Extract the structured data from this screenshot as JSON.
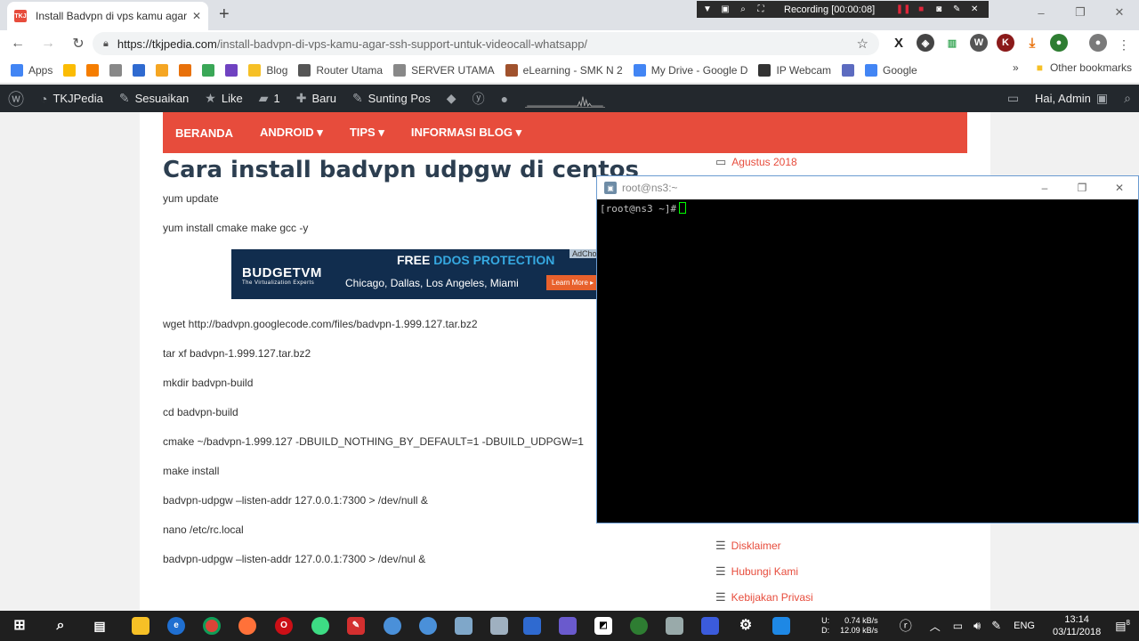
{
  "browser": {
    "tab_title": "Install Badvpn di vps kamu agar s",
    "new_tab": "+",
    "url_host": "https://tkjpedia.com",
    "url_path": "/install-badvpn-di-vps-kamu-agar-ssh-support-untuk-videocall-whatsapp/",
    "window_controls": [
      "–",
      "❐",
      "✕"
    ],
    "recording_label": "Recording [00:00:08]"
  },
  "bookmarks": {
    "items": [
      {
        "label": "Apps",
        "icon": "apps-grid-icon",
        "color": "#4285f4"
      },
      {
        "label": "",
        "icon": "google-ads-icon",
        "color": "#fbbc04"
      },
      {
        "label": "",
        "icon": "blogger-icon",
        "color": "#f57d00"
      },
      {
        "label": "",
        "icon": "page-icon",
        "color": "#888888"
      },
      {
        "label": "",
        "icon": "router-icon",
        "color": "#2f6ad0"
      },
      {
        "label": "",
        "icon": "signal-icon",
        "color": "#f5a623"
      },
      {
        "label": "",
        "icon": "analytics-icon",
        "color": "#e8710a"
      },
      {
        "label": "",
        "icon": "green-app-icon",
        "color": "#3aa757"
      },
      {
        "label": "",
        "icon": "b-icon",
        "color": "#6f42c1"
      },
      {
        "label": "Blog",
        "icon": "folder-icon",
        "color": "#f6c026"
      },
      {
        "label": "Router Utama",
        "icon": "router-icon",
        "color": "#555555"
      },
      {
        "label": "SERVER UTAMA",
        "icon": "page-icon",
        "color": "#888888"
      },
      {
        "label": "eLearning - SMK N 2",
        "icon": "school-icon",
        "color": "#a0522d"
      },
      {
        "label": "My Drive - Google D",
        "icon": "google-icon",
        "color": "#4285f4"
      },
      {
        "label": "IP Webcam",
        "icon": "webcam-icon",
        "color": "#333333"
      },
      {
        "label": "",
        "icon": "puzzle-icon",
        "color": "#5c6bc0"
      },
      {
        "label": "Google",
        "icon": "google-icon",
        "color": "#4285f4"
      }
    ],
    "more": "»",
    "other": "Other bookmarks"
  },
  "wpbar": {
    "site": "TKJPedia",
    "customize": "Sesuaikan",
    "like": "Like",
    "comments": "1",
    "new": "Baru",
    "edit": "Sunting Pos",
    "greeting": "Hai, Admin"
  },
  "site_nav": [
    "BERANDA",
    "ANDROID ▾",
    "TIPS ▾",
    "INFORMASI BLOG ▾"
  ],
  "article": {
    "heading": "Cara install badvpn udpgw di centos",
    "lines": [
      "yum update",
      "yum install cmake make gcc -y",
      "wget http://badvpn.googlecode.com/files/badvpn-1.999.127.tar.bz2",
      "tar xf badvpn-1.999.127.tar.bz2",
      "mkdir badvpn-build",
      "cd badvpn-build",
      "cmake ~/badvpn-1.999.127 -DBUILD_NOTHING_BY_DEFAULT=1 -DBUILD_UDPGW=1",
      "make install",
      "badvpn-udpgw –listen-addr 127.0.0.1:7300 > /dev/null &",
      "nano /etc/rc.local",
      "badvpn-udpgw –listen-addr 127.0.0.1:7300 > /dev/nul &"
    ]
  },
  "ad": {
    "brand": "BUDGETVM",
    "tagline": "The Virtualization Experts",
    "headline_a": "FREE ",
    "headline_b": "DDOS PROTECTION",
    "cities": "Chicago, Dallas, Los Angeles, Miami",
    "cta": "Learn More ▸",
    "adchoices": "AdChoic"
  },
  "sidebar": {
    "archive": "Agustus 2018",
    "pages": [
      "Disklaimer",
      "Hubungi Kami",
      "Kebijakan Privasi"
    ]
  },
  "putty": {
    "title": "root@ns3:~",
    "prompt": "[root@ns3 ~]#"
  },
  "taskbar": {
    "net_up_label": "U:",
    "net_down_label": "D:",
    "net_up": "0.74 kB/s",
    "net_down": "12.09 kB/s",
    "lang": "ENG",
    "time": "13:14",
    "date": "03/11/2018",
    "notifications": "8"
  }
}
